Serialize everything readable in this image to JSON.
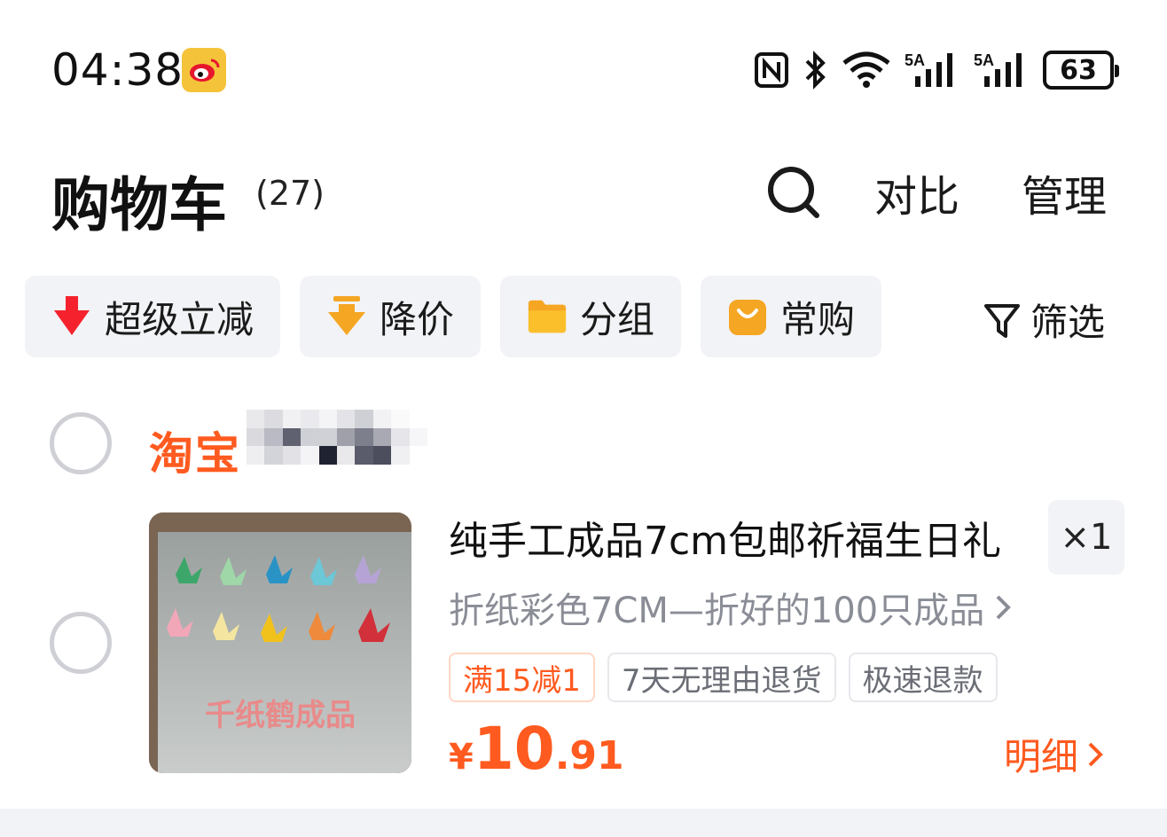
{
  "status_bar": {
    "time": "04:38",
    "battery": "63",
    "signal1": "5A",
    "signal2": "5A",
    "icons": [
      "weibo-icon",
      "nfc-icon",
      "bluetooth-icon",
      "wifi-icon",
      "signal-icon",
      "signal-icon",
      "battery-icon"
    ]
  },
  "header": {
    "title": "购物车",
    "count": "(27)",
    "compare_label": "对比",
    "manage_label": "管理"
  },
  "chips": [
    {
      "label": "超级立减",
      "icon": "arrow-down-icon",
      "color": "#f5222d"
    },
    {
      "label": "降价",
      "icon": "price-drop-icon",
      "color": "#f5a623"
    },
    {
      "label": "分组",
      "icon": "folder-icon",
      "color": "#f5a623"
    },
    {
      "label": "常购",
      "icon": "bag-icon",
      "color": "#f5a623"
    }
  ],
  "filter_label": "筛选",
  "store": {
    "name": "淘宝"
  },
  "item": {
    "title": "纯手工成品7cm包邮祈福生日礼",
    "sku": "折纸彩色7CM—折好的100只成品",
    "quantity": "×1",
    "tags": [
      "满15减1",
      "7天无理由退货",
      "极速退款"
    ],
    "price_currency": "¥",
    "price_int": "10",
    "price_dec": ".91",
    "detail_label": "明细",
    "image_caption": "千纸鹤成品"
  },
  "colors": {
    "accent": "#ff5a1f",
    "chip_bg": "#f2f3f6"
  }
}
